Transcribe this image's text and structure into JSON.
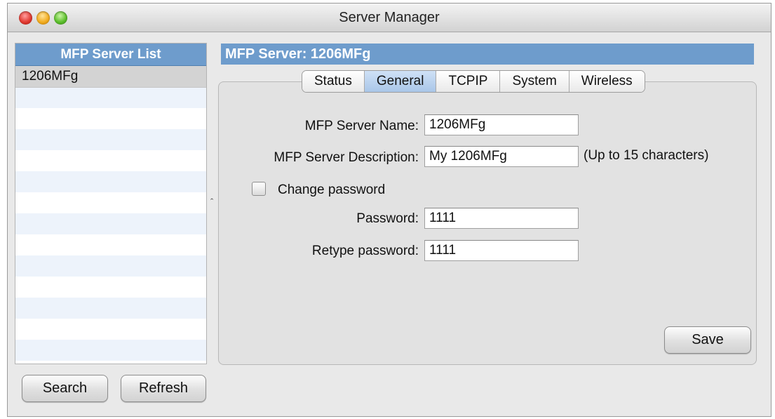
{
  "window": {
    "title": "Server Manager"
  },
  "server_list": {
    "header": "MFP Server List",
    "items": [
      {
        "label": "1206MFg"
      }
    ]
  },
  "buttons": {
    "search": "Search",
    "refresh": "Refresh",
    "save": "Save"
  },
  "server_header": "MFP Server: 1206MFg",
  "tabs": [
    {
      "label": "Status",
      "active": false
    },
    {
      "label": "General",
      "active": true
    },
    {
      "label": "TCPIP",
      "active": false
    },
    {
      "label": "System",
      "active": false
    },
    {
      "label": "Wireless",
      "active": false
    }
  ],
  "form": {
    "name_label": "MFP Server Name:",
    "name_value": "1206MFg",
    "description_label": "MFP Server Description:",
    "description_value": "My 1206MFg",
    "description_hint": "(Up to 15 characters)",
    "change_password_label": "Change password",
    "change_password_checked": false,
    "password_label": "Password:",
    "password_value": "1111",
    "retype_label": "Retype password:",
    "retype_value": "1111"
  },
  "colors": {
    "accent": "#6e9ccc",
    "selected_tab": "#a9c6e8"
  }
}
